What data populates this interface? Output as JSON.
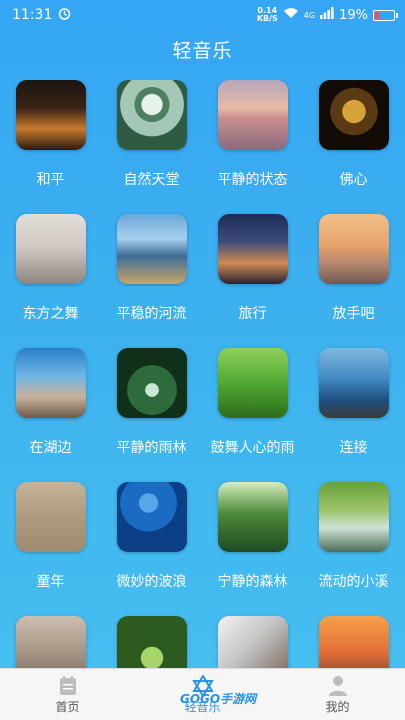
{
  "status": {
    "time": "11:31",
    "net_speed": "0.14",
    "net_unit": "KB/S",
    "signal": "4G",
    "battery": "19%",
    "battery_level": 0.19
  },
  "header": {
    "title": "轻音乐"
  },
  "tracks": [
    {
      "label": "和平"
    },
    {
      "label": "自然天堂"
    },
    {
      "label": "平静的状态"
    },
    {
      "label": "佛心"
    },
    {
      "label": "东方之舞"
    },
    {
      "label": "平稳的河流"
    },
    {
      "label": "旅行"
    },
    {
      "label": "放手吧"
    },
    {
      "label": "在湖边"
    },
    {
      "label": "平静的雨林"
    },
    {
      "label": "鼓舞人心的雨"
    },
    {
      "label": "连接"
    },
    {
      "label": "童年"
    },
    {
      "label": "微妙的波浪"
    },
    {
      "label": "宁静的森林"
    },
    {
      "label": "流动的小溪"
    },
    {
      "label": ""
    },
    {
      "label": ""
    },
    {
      "label": ""
    },
    {
      "label": ""
    }
  ],
  "nav": {
    "home": "首页",
    "music": "轻音乐",
    "mine": "我的"
  },
  "watermark": "GOGO手游网"
}
